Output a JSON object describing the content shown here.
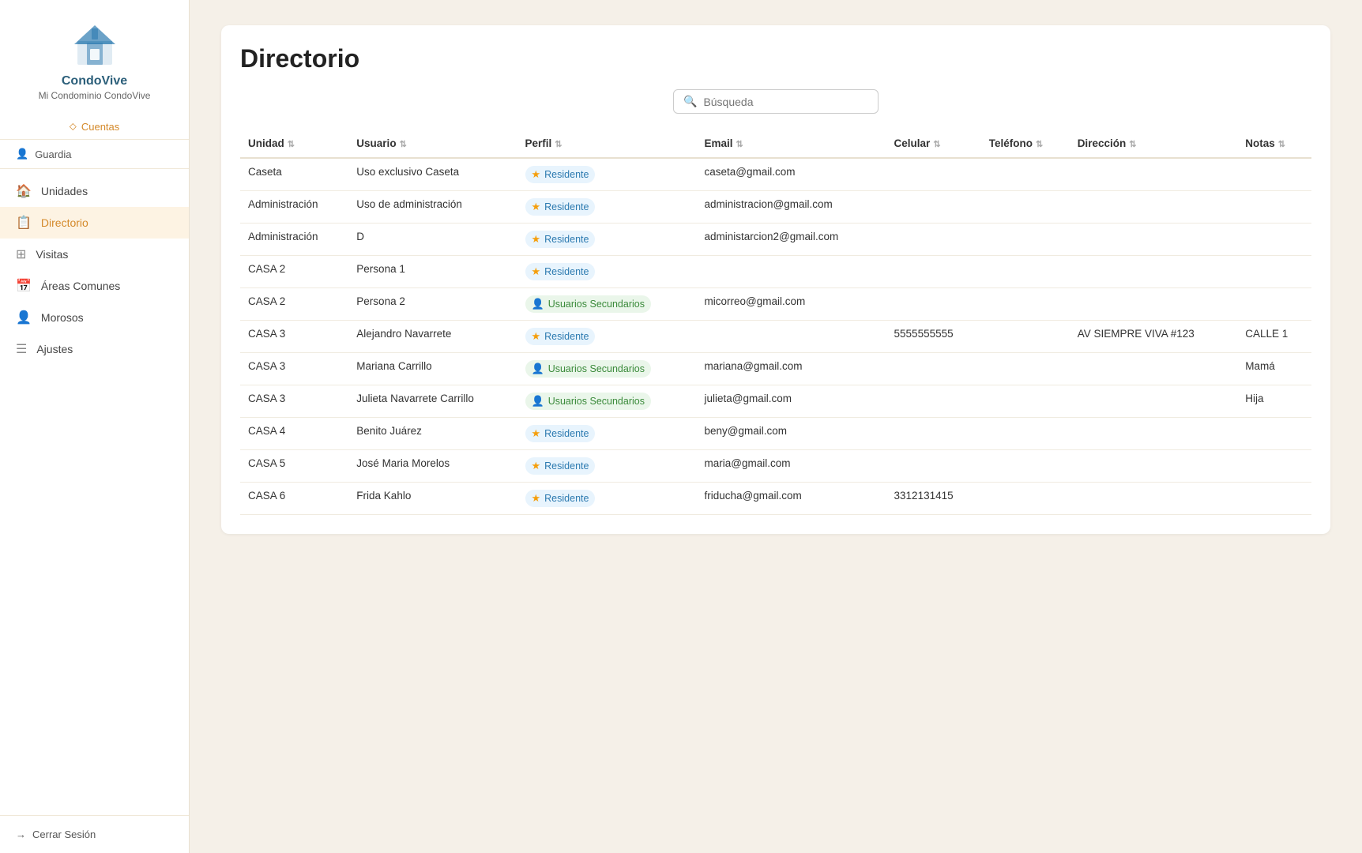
{
  "sidebar": {
    "app_name": "CondoVive",
    "condo_name": "Mi Condominio CondoVive",
    "accounts_label": "Cuentas",
    "user_label": "Guardia",
    "nav_items": [
      {
        "id": "unidades",
        "label": "Unidades",
        "icon": "🏠"
      },
      {
        "id": "directorio",
        "label": "Directorio",
        "icon": "📋",
        "active": true
      },
      {
        "id": "visitas",
        "label": "Visitas",
        "icon": "⊞"
      },
      {
        "id": "areas",
        "label": "Áreas Comunes",
        "icon": "📅"
      },
      {
        "id": "morosos",
        "label": "Morosos",
        "icon": "👤"
      },
      {
        "id": "ajustes",
        "label": "Ajustes",
        "icon": "☰"
      }
    ],
    "logout_label": "Cerrar Sesión"
  },
  "page": {
    "title": "Directorio",
    "search_placeholder": "Búsqueda"
  },
  "table": {
    "columns": [
      {
        "key": "unidad",
        "label": "Unidad"
      },
      {
        "key": "usuario",
        "label": "Usuario"
      },
      {
        "key": "perfil",
        "label": "Perfil"
      },
      {
        "key": "email",
        "label": "Email"
      },
      {
        "key": "celular",
        "label": "Celular"
      },
      {
        "key": "telefono",
        "label": "Teléfono"
      },
      {
        "key": "direccion",
        "label": "Dirección"
      },
      {
        "key": "notas",
        "label": "Notas"
      }
    ],
    "rows": [
      {
        "unidad": "Caseta",
        "usuario": "Uso exclusivo Caseta",
        "perfil": "Residente",
        "perfil_type": "residente",
        "email": "caseta@gmail.com",
        "celular": "",
        "telefono": "",
        "direccion": "",
        "notas": ""
      },
      {
        "unidad": "Administración",
        "usuario": "Uso de administración",
        "perfil": "Residente",
        "perfil_type": "residente",
        "email": "administracion@gmail.com",
        "celular": "",
        "telefono": "",
        "direccion": "",
        "notas": ""
      },
      {
        "unidad": "Administración",
        "usuario": "D",
        "perfil": "Residente",
        "perfil_type": "residente",
        "email": "administarcion2@gmail.com",
        "celular": "",
        "telefono": "",
        "direccion": "",
        "notas": ""
      },
      {
        "unidad": "CASA 2",
        "usuario": "Persona 1",
        "perfil": "Residente",
        "perfil_type": "residente",
        "email": "",
        "celular": "",
        "telefono": "",
        "direccion": "",
        "notas": ""
      },
      {
        "unidad": "CASA 2",
        "usuario": "Persona 2",
        "perfil": "Usuarios Secundarios",
        "perfil_type": "secundario",
        "email": "micorreo@gmail.com",
        "celular": "",
        "telefono": "",
        "direccion": "",
        "notas": ""
      },
      {
        "unidad": "CASA 3",
        "usuario": "Alejandro Navarrete",
        "perfil": "Residente",
        "perfil_type": "residente",
        "email": "",
        "celular": "5555555555",
        "telefono": "",
        "direccion": "AV SIEMPRE VIVA #123",
        "notas": "CALLE 1"
      },
      {
        "unidad": "CASA 3",
        "usuario": "Mariana Carrillo",
        "perfil": "Usuarios Secundarios",
        "perfil_type": "secundario",
        "email": "mariana@gmail.com",
        "celular": "",
        "telefono": "",
        "direccion": "",
        "notas": "Mamá"
      },
      {
        "unidad": "CASA 3",
        "usuario": "Julieta Navarrete Carrillo",
        "perfil": "Usuarios Secundarios",
        "perfil_type": "secundario",
        "email": "julieta@gmail.com",
        "celular": "",
        "telefono": "",
        "direccion": "",
        "notas": "Hija"
      },
      {
        "unidad": "CASA 4",
        "usuario": "Benito Juárez",
        "perfil": "Residente",
        "perfil_type": "residente",
        "email": "beny@gmail.com",
        "celular": "",
        "telefono": "",
        "direccion": "",
        "notas": ""
      },
      {
        "unidad": "CASA 5",
        "usuario": "José Maria Morelos",
        "perfil": "Residente",
        "perfil_type": "residente",
        "email": "maria@gmail.com",
        "celular": "",
        "telefono": "",
        "direccion": "",
        "notas": ""
      },
      {
        "unidad": "CASA 6",
        "usuario": "Frida Kahlo",
        "perfil": "Residente",
        "perfil_type": "residente",
        "email": "friducha@gmail.com",
        "celular": "3312131415",
        "telefono": "",
        "direccion": "",
        "notas": ""
      }
    ]
  }
}
